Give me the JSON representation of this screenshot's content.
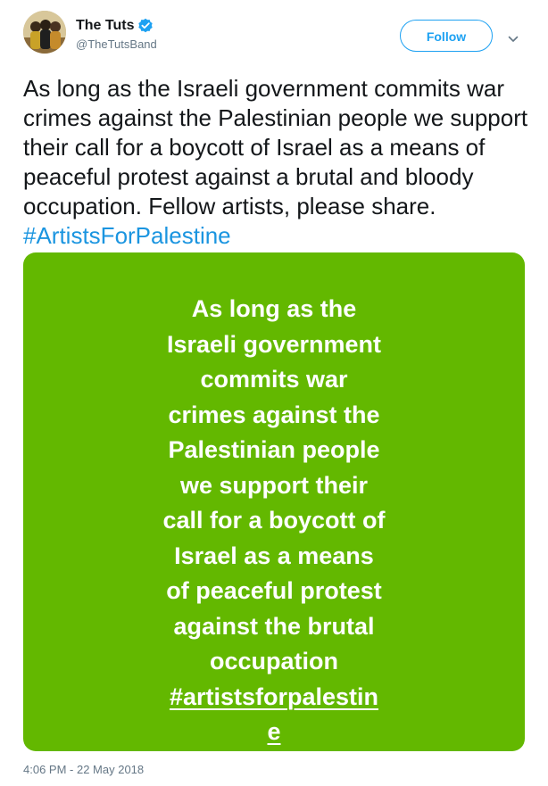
{
  "author": {
    "display_name": "The Tuts",
    "handle": "@TheTutsBand",
    "avatar_icon": "band-photo-avatar",
    "verified_icon": "verified-badge-icon"
  },
  "follow_button": {
    "label": "Follow"
  },
  "menu_icon": "chevron-down-icon",
  "tweet": {
    "text": "As long as the Israeli government commits war crimes against the Palestinian people we support their call for a boycott of Israel as a means of peaceful protest against a brutal and bloody occupation. Fellow artists, please share. ",
    "hashtag": "#ArtistsForPalestine",
    "timestamp": "4:06 PM - 22 May 2018"
  },
  "media": {
    "lines": [
      "As long as the",
      "Israeli government",
      "commits war",
      "crimes against the",
      "Palestinian people",
      "we support their",
      "call for a boycott of",
      "Israel as a means",
      "of peaceful protest",
      "against the brutal",
      "occupation"
    ],
    "hashtag_lines": [
      "#artistsforpalestin",
      "e"
    ]
  },
  "colors": {
    "brand_blue": "#1da1f2",
    "link_blue": "#1b95e0",
    "media_background": "#63b800",
    "secondary_text": "#657786"
  }
}
